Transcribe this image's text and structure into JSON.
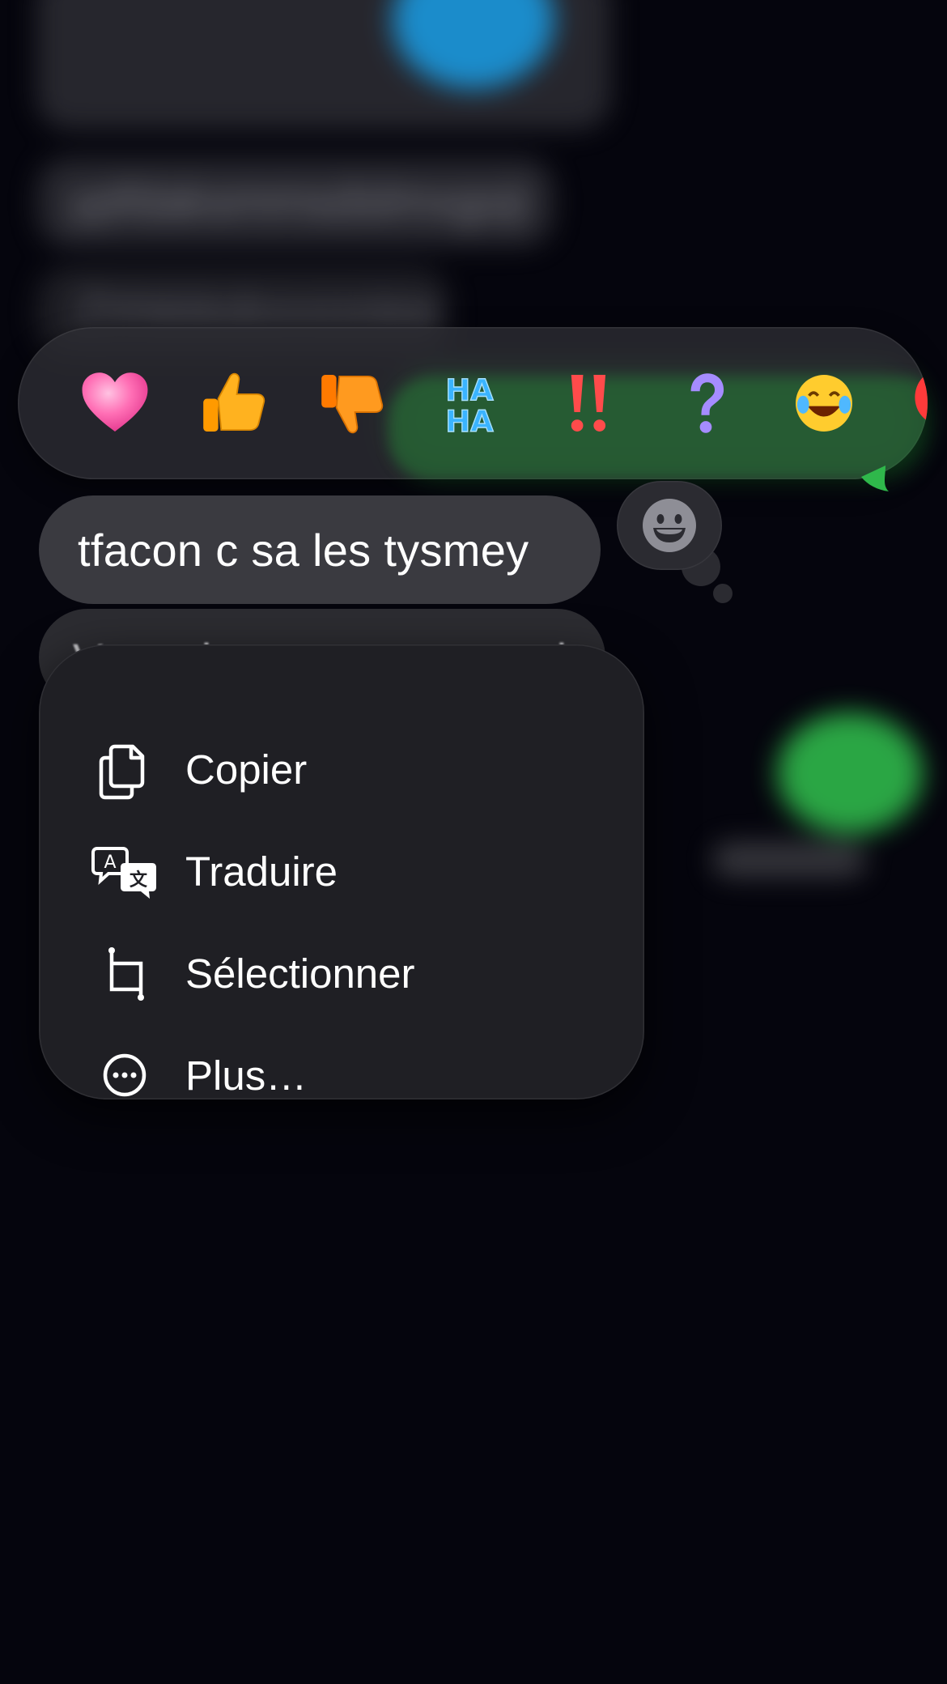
{
  "background": {
    "blurred_text_1": "Zhhkkkdoxxoxiea",
    "blurred_text_2": "ypfdaksmmsdslmxgoji",
    "blurred_text_3": "Vous devez couter ma vie"
  },
  "reactions": [
    {
      "name": "heart",
      "color": "#ff6fb5"
    },
    {
      "name": "thumbs-up",
      "color": "#ffb21f"
    },
    {
      "name": "thumbs-down",
      "color": "#ff9a1f"
    },
    {
      "name": "haha",
      "color": "#3ab4ff"
    },
    {
      "name": "exclamation",
      "color": "#ff4b4b"
    },
    {
      "name": "question",
      "color": "#a58cff"
    },
    {
      "name": "laughing",
      "color": "#ffcc2e"
    },
    {
      "name": "balloon",
      "color": "#ff3a3a"
    }
  ],
  "message": {
    "text": "tfacon c sa les tysmey",
    "next_text": "Vous devez couter ma vie"
  },
  "menu": {
    "items": [
      {
        "label": "Copier",
        "icon": "copy-icon"
      },
      {
        "label": "Traduire",
        "icon": "translate-icon"
      },
      {
        "label": "Sélectionner",
        "icon": "crop-select-icon"
      },
      {
        "label": "Plus…",
        "icon": "more-icon"
      }
    ]
  },
  "colors": {
    "background": "#05050d",
    "menu": "#1f1f24",
    "bubble": "#3a3a40",
    "green": "#2fb84b"
  }
}
